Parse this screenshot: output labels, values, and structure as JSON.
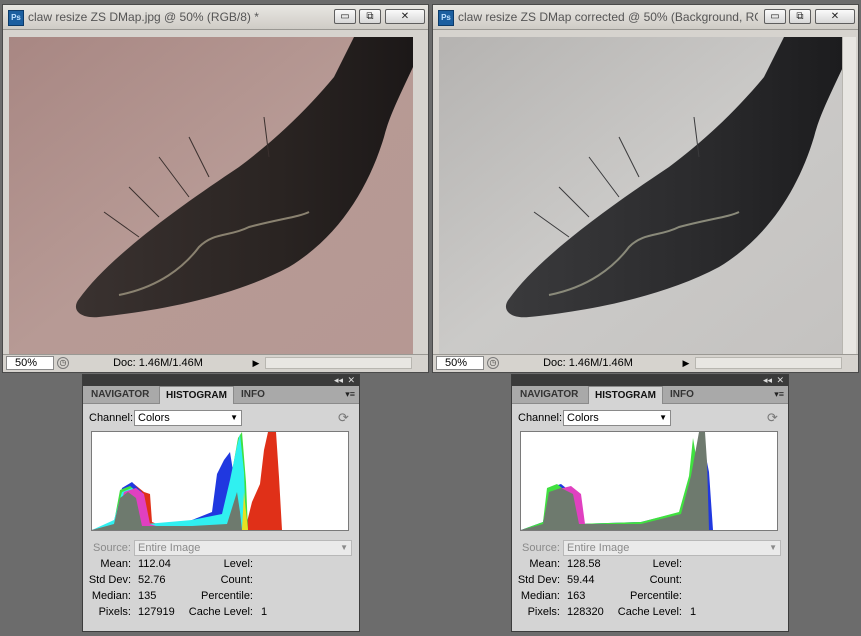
{
  "documents": [
    {
      "title": "claw resize ZS DMap.jpg @ 50% (RGB/8) *",
      "zoom": "50%",
      "doc_info": "Doc: 1.46M/1.46M",
      "bg_color": "#b29490"
    },
    {
      "title": "claw resize ZS DMap corrected @ 50% (Background, RG...",
      "zoom": "50%",
      "doc_info": "Doc: 1.46M/1.46M",
      "bg_color": "#c6c4c2"
    }
  ],
  "window_buttons": {
    "minimize": "▭",
    "restore": "⧉",
    "close": "✕"
  },
  "panels": [
    {
      "tabs": [
        "NAVIGATOR",
        "HISTOGRAM",
        "INFO"
      ],
      "active_tab": "HISTOGRAM",
      "channel_label": "Channel:",
      "channel_value": "Colors",
      "source_label": "Source:",
      "source_value": "Entire Image",
      "stats": {
        "mean_label": "Mean:",
        "mean": "112.04",
        "std_label": "Std Dev:",
        "std": "52.76",
        "median_label": "Median:",
        "median": "135",
        "pixels_label": "Pixels:",
        "pixels": "127919",
        "level_label": "Level:",
        "count_label": "Count:",
        "percentile_label": "Percentile:",
        "cache_label": "Cache Level:",
        "cache": "1"
      }
    },
    {
      "tabs": [
        "NAVIGATOR",
        "HISTOGRAM",
        "INFO"
      ],
      "active_tab": "HISTOGRAM",
      "channel_label": "Channel:",
      "channel_value": "Colors",
      "source_label": "Source:",
      "source_value": "Entire Image",
      "stats": {
        "mean_label": "Mean:",
        "mean": "128.58",
        "std_label": "Std Dev:",
        "std": "59.44",
        "median_label": "Median:",
        "median": "163",
        "pixels_label": "Pixels:",
        "pixels": "128320",
        "level_label": "Level:",
        "count_label": "Count:",
        "percentile_label": "Percentile:",
        "cache_label": "Cache Level:",
        "cache": "1"
      }
    }
  ]
}
